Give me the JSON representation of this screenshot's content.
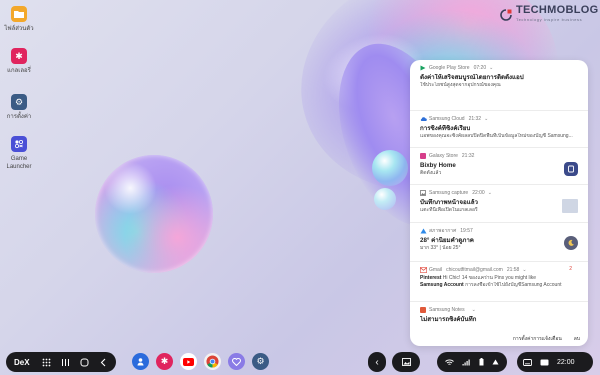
{
  "desktop_icons": [
    {
      "label": "ไฟล์ส่วนตัว",
      "icon": "folder-icon",
      "color": "#f3a82b"
    },
    {
      "label": "แกลเลอรี่",
      "icon": "gallery-icon",
      "color": "#e0245e"
    },
    {
      "label": "การตั้งค่า",
      "icon": "settings-icon",
      "color": "#3b5b85"
    },
    {
      "label": "Game",
      "label2": "Launcher",
      "icon": "game-launcher-icon",
      "color": "#4a4fd6"
    }
  ],
  "brand": {
    "name": "TECHMOBLOG",
    "tagline": "Technology inspire business"
  },
  "notifications": [
    {
      "app": "Google Play Store",
      "time": "07:20",
      "title": "ตั้งค่าให้เสร็จสมบูรณ์โดยการติดตั้งแอป",
      "body": "ใช้ประโยชน์สูงสุดจากอุปกรณ์ของคุณ",
      "app_color": "#1aa260"
    },
    {
      "app": "Samsung Cloud",
      "time": "21:32",
      "title": "การซิงค์ที่ซิงค์เรียบ",
      "body": "แอพของคุณจะซิงค์ผลลบปิดปิดพื้นที่เป็นข้อมูลใหม่ของบัญชี Samsung...",
      "app_color": "#2d6fd8"
    },
    {
      "app": "Galaxy Store",
      "time": "21:32",
      "title": "Bixby Home",
      "body": "ติดตั้งแล้ว",
      "app_color": "#d63e8a",
      "thumb": "#3b4a8a"
    },
    {
      "app": "Samsung capture",
      "time": "22:00",
      "title": "บันทึกภาพหน้าจอแล้ว",
      "body": "แตะที่นี่เพื่อเปิดในแกลเลอรี่",
      "app_color": "#777777",
      "thumb": "#cfd6e4"
    },
    {
      "app": "สภาพอากาศ",
      "time": "19:57",
      "title": "28° ค่านิยมคำดูภาค",
      "body": "มาก 33° | น้อย 25°",
      "app_color": "#2f8ae8",
      "thumb": "#5a5f7a"
    },
    {
      "app": "Gmail",
      "email": "chicoutfitmail@gmail.com",
      "time": "21:58",
      "title": "Pinterest",
      "title_extra": "Hi Chic! 14 ของแคร่าน Pins you might like",
      "title2": "Samsung Account",
      "title2_extra": "การลงชื่อเข้าใช้ไปยังบัญชีSamsung Account",
      "app_color": "#e0463b",
      "count": "2"
    },
    {
      "app": "Samsung Notes",
      "time": "",
      "title": "ไม่สามารถซิงค์บันทึก",
      "body": "",
      "app_color": "#e05a3b"
    }
  ],
  "panel_footer": {
    "settings": "การตั้งค่าการแจ้งเตือน",
    "clear": "ลบ"
  },
  "taskbar": {
    "dex_label": "DeX",
    "time": "22:00",
    "apps": [
      {
        "icon": "bixby-icon",
        "color": "#2b6bdc"
      },
      {
        "icon": "gallery-icon",
        "color": "#e0245e"
      },
      {
        "icon": "youtube-icon",
        "color": "#ff0000"
      },
      {
        "icon": "chrome-icon",
        "color": "#f2f2f2"
      },
      {
        "icon": "heart-icon",
        "color": "#8a7be6"
      },
      {
        "icon": "settings-icon",
        "color": "#3b5b85"
      }
    ]
  }
}
